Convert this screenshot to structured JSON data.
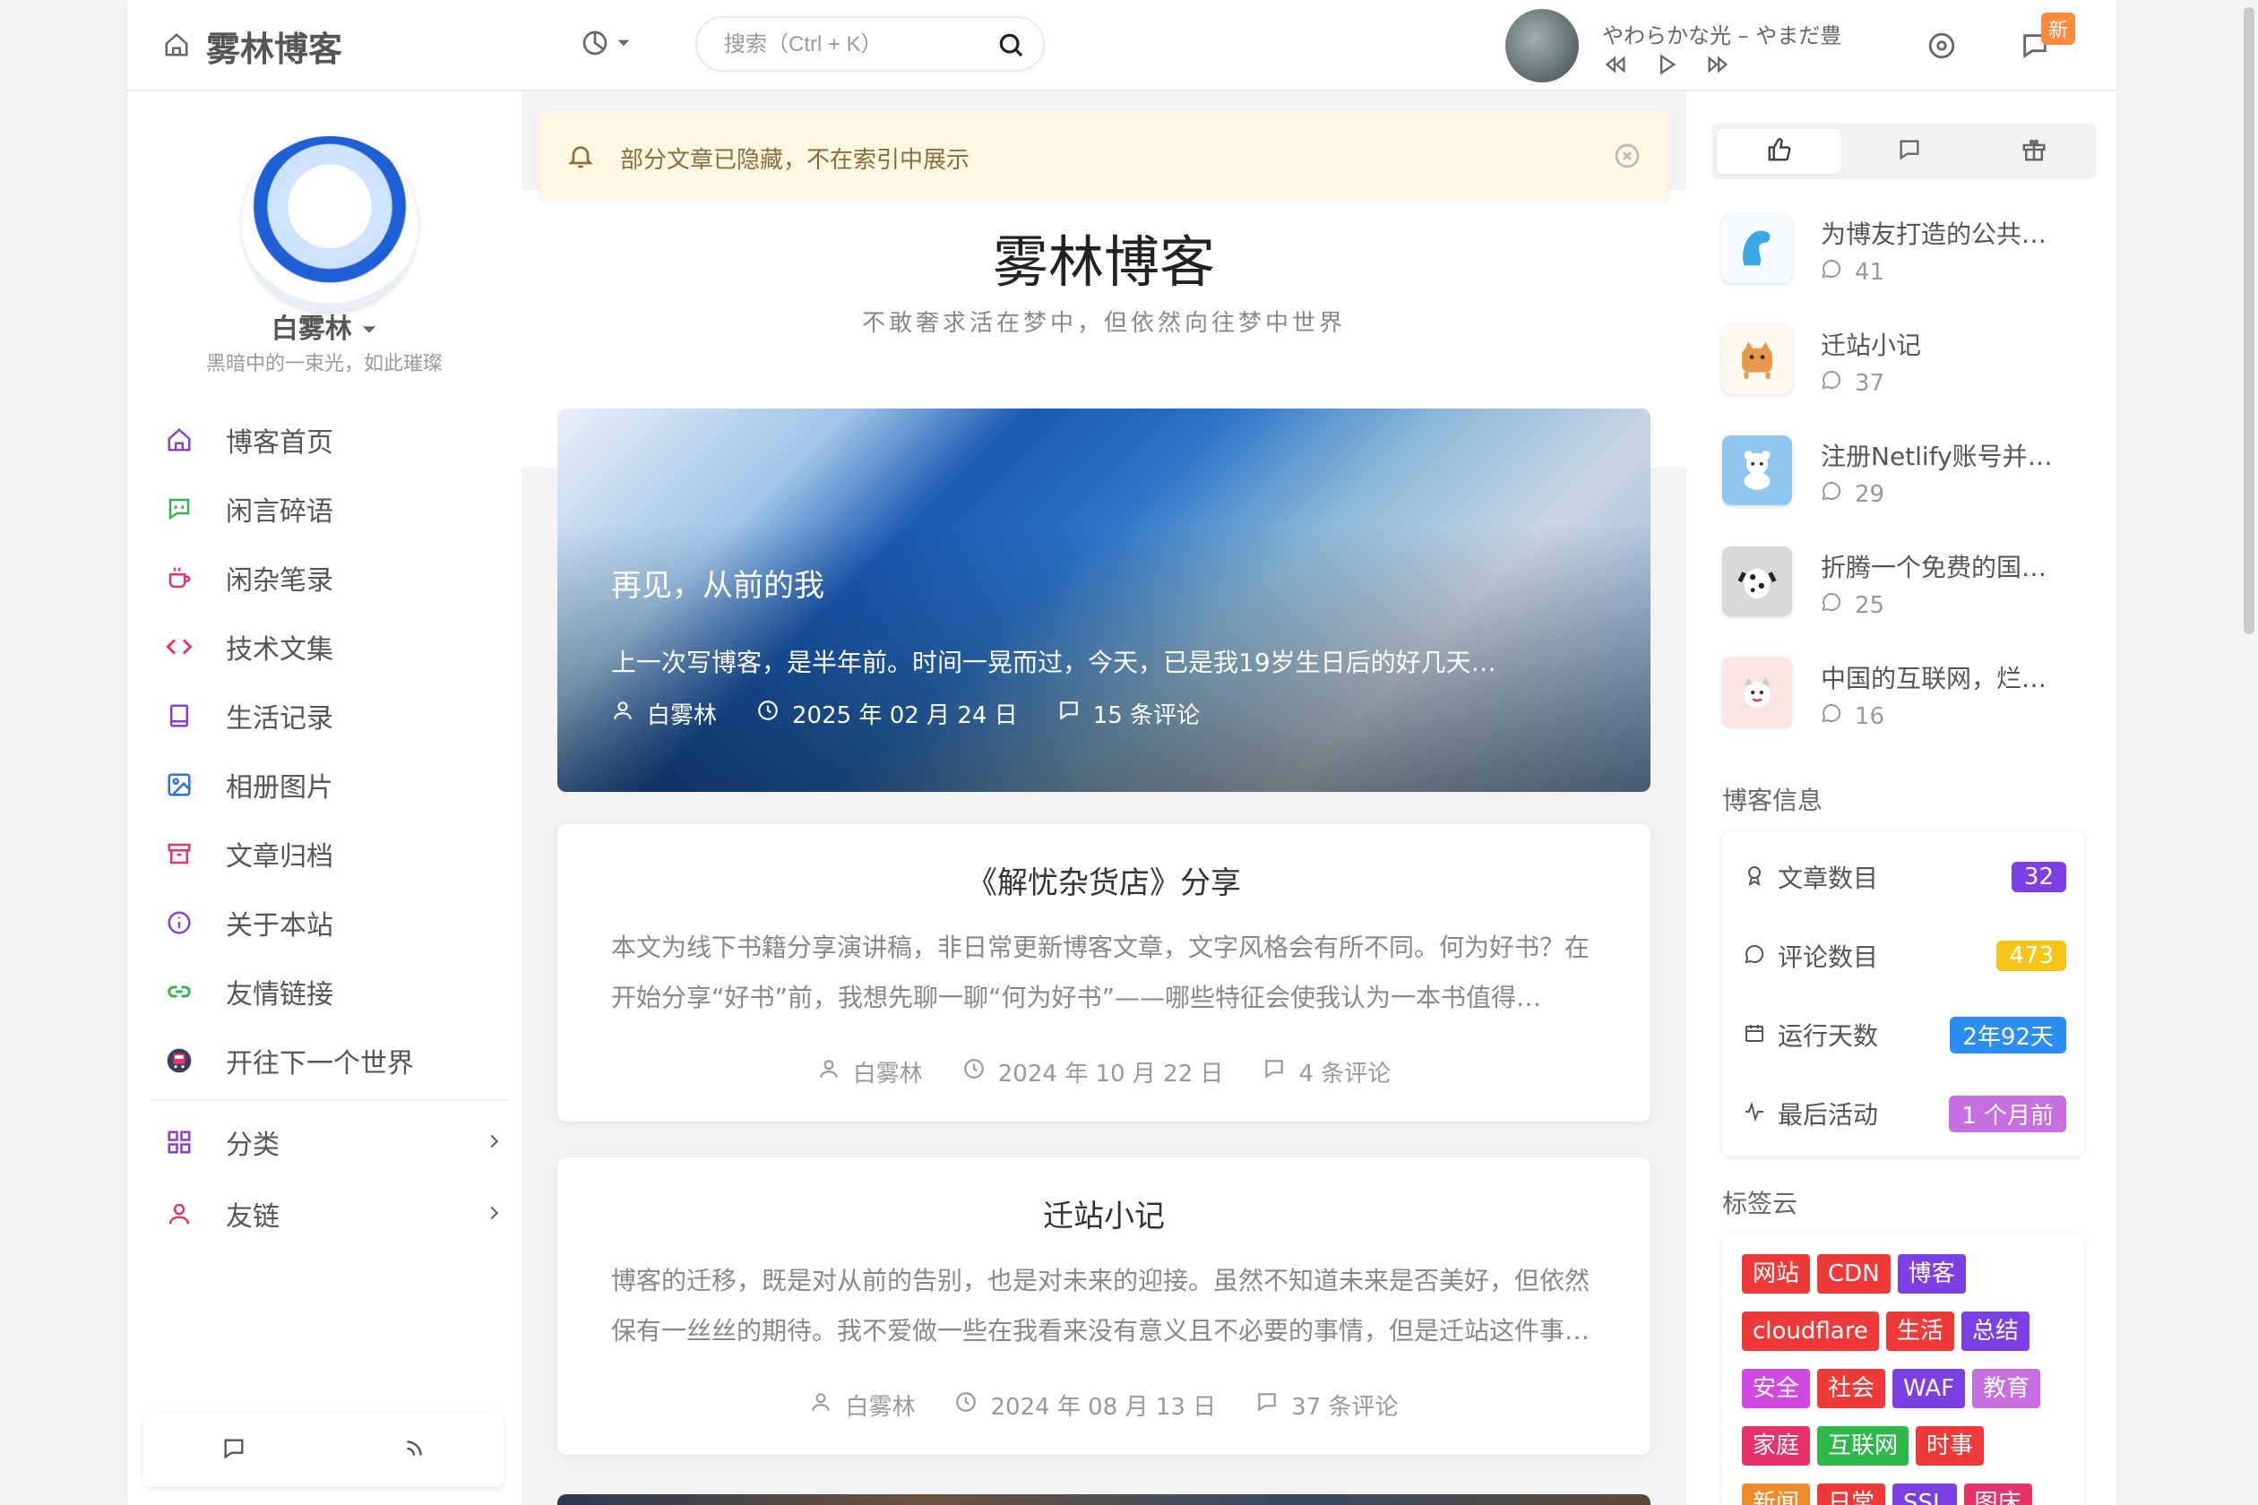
{
  "header": {
    "brand": "雾林博客",
    "search_placeholder": "搜索（Ctrl + K）",
    "song": "やわらかな光 – やまだ豊",
    "new_badge": "新"
  },
  "profile": {
    "name": "白雾林",
    "motto": "黑暗中的一束光，如此璀璨"
  },
  "nav": {
    "items": [
      {
        "label": "博客首页",
        "icon": "home-icon"
      },
      {
        "label": "闲言碎语",
        "icon": "chat-icon"
      },
      {
        "label": "闲杂笔录",
        "icon": "coffee-icon"
      },
      {
        "label": "技术文集",
        "icon": "code-icon"
      },
      {
        "label": "生活记录",
        "icon": "book-icon"
      },
      {
        "label": "相册图片",
        "icon": "image-icon"
      },
      {
        "label": "文章归档",
        "icon": "archive-icon"
      },
      {
        "label": "关于本站",
        "icon": "info-icon"
      },
      {
        "label": "友情链接",
        "icon": "link-icon"
      },
      {
        "label": "开往下一个世界",
        "icon": "train-icon"
      }
    ],
    "groups": [
      {
        "label": "分类"
      },
      {
        "label": "友链"
      }
    ]
  },
  "notice": {
    "text": "部分文章已隐藏，不在索引中展示"
  },
  "site": {
    "title": "雾林博客",
    "subtitle": "不敢奢求活在梦中，但依然向往梦中世界"
  },
  "hero": {
    "title": "再见，从前的我",
    "excerpt": "上一次写博客，是半年前。时间一晃而过，今天，已是我19岁生日后的好几天…",
    "author": "白雾林",
    "date": "2025 年 02 月 24 日",
    "comments": "15 条评论"
  },
  "posts": [
    {
      "title": "《解忧杂货店》分享",
      "excerpt": "本文为线下书籍分享演讲稿，非日常更新博客文章，文字风格会有所不同。何为好书？在开始分享“好书”前，我想先聊一聊“何为好书”——哪些特征会使我认为一本书值得…",
      "author": "白雾林",
      "date": "2024 年 10 月 22 日",
      "comments": "4 条评论"
    },
    {
      "title": "迁站小记",
      "excerpt": "博客的迁移，既是对从前的告别，也是对未来的迎接。虽然不知道未来是否美好，但依然保有一丝丝的期待。我不爱做一些在我看来没有意义且不必要的事情，但是迁站这件事…",
      "author": "白雾林",
      "date": "2024 年 08 月 13 日",
      "comments": "37 条评论"
    }
  ],
  "popular": [
    {
      "title": "为博友打造的公共…",
      "count": "41",
      "thumb_color": "#3aa7e8"
    },
    {
      "title": "迁站小记",
      "count": "37",
      "thumb_color": "#e89a4a"
    },
    {
      "title": "注册Netlify账号并…",
      "count": "29",
      "thumb_color": "#a6cde8"
    },
    {
      "title": "折腾一个免费的国…",
      "count": "25",
      "thumb_color": "#c8c8c8"
    },
    {
      "title": "中国的互联网，烂…",
      "count": "16",
      "thumb_color": "#f0b5b5"
    }
  ],
  "blog_info": {
    "title": "博客信息",
    "rows": [
      {
        "label": "文章数目",
        "value": "32",
        "color": "#7b3fe4"
      },
      {
        "label": "评论数目",
        "value": "473",
        "color": "#f5c518"
      },
      {
        "label": "运行天数",
        "value": "2年92天",
        "color": "#2b8ef0"
      },
      {
        "label": "最后活动",
        "value": "1 个月前",
        "color": "#c86ee0"
      }
    ]
  },
  "tag_cloud": {
    "title": "标签云",
    "rows": [
      [
        {
          "t": "网站",
          "c": "#f03a3a"
        },
        {
          "t": "CDN",
          "c": "#f03a3a"
        },
        {
          "t": "博客",
          "c": "#7b3fe4"
        }
      ],
      [
        {
          "t": "cloudflare",
          "c": "#f03a3a"
        },
        {
          "t": "生活",
          "c": "#f03a3a"
        },
        {
          "t": "总结",
          "c": "#7b3fe4"
        }
      ],
      [
        {
          "t": "安全",
          "c": "#d04ae0"
        },
        {
          "t": "社会",
          "c": "#f03a3a"
        },
        {
          "t": "WAF",
          "c": "#7b3fe4"
        },
        {
          "t": "教育",
          "c": "#c86ee0"
        }
      ],
      [
        {
          "t": "家庭",
          "c": "#e8336a"
        },
        {
          "t": "互联网",
          "c": "#2fb84a"
        },
        {
          "t": "时事",
          "c": "#f03a3a"
        }
      ],
      [
        {
          "t": "新闻",
          "c": "#f08a28"
        },
        {
          "t": "日常",
          "c": "#f03a3a"
        },
        {
          "t": "SSL",
          "c": "#7b3fe4"
        },
        {
          "t": "图床",
          "c": "#e8336a"
        }
      ]
    ]
  },
  "colors": {
    "accent": "#8a3fd0"
  }
}
